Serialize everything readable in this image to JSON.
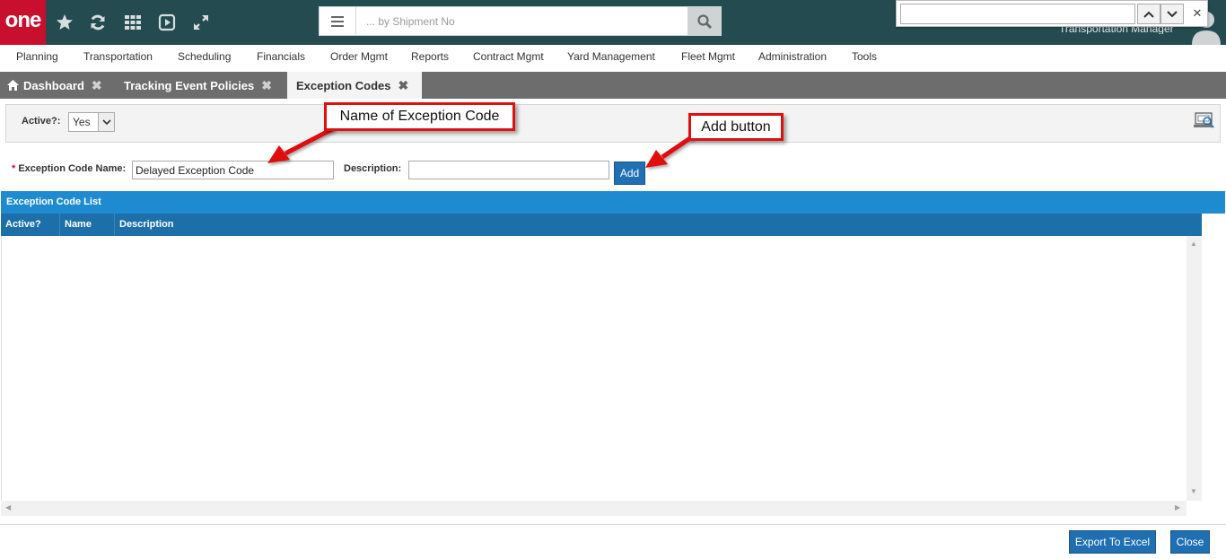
{
  "app": {
    "logo_text": "one",
    "user_role": "Transportation Manager"
  },
  "search": {
    "placeholder": "... by Shipment No"
  },
  "findbar": {
    "value": ""
  },
  "menu": [
    {
      "label": "Planning"
    },
    {
      "label": "Transportation"
    },
    {
      "label": "Scheduling"
    },
    {
      "label": "Financials"
    },
    {
      "label": "Order Mgmt"
    },
    {
      "label": "Reports"
    },
    {
      "label": "Contract Mgmt"
    },
    {
      "label": "Yard Management"
    },
    {
      "label": "Fleet Mgmt"
    },
    {
      "label": "Administration"
    },
    {
      "label": "Tools"
    }
  ],
  "tabs": [
    {
      "label": "Dashboard",
      "icon": "home-icon"
    },
    {
      "label": "Tracking Event Policies"
    },
    {
      "label": "Exception Codes",
      "active": true
    }
  ],
  "filter": {
    "active_label": "Active?:",
    "active_value": "Yes"
  },
  "form": {
    "required_mark": "*",
    "name_label": "Exception Code Name:",
    "name_value": "Delayed Exception Code",
    "description_label": "Description:",
    "description_value": "",
    "add_label": "Add"
  },
  "grid": {
    "title": "Exception Code List",
    "columns": [
      "Active?",
      "Name",
      "Description"
    ],
    "rows": []
  },
  "footer": {
    "export_label": "Export To Excel",
    "close_label": "Close"
  },
  "callouts": {
    "name": "Name of Exception Code",
    "add": "Add button"
  },
  "colors": {
    "topbar": "#244b4f",
    "logo": "#c8102e",
    "accent_blue": "#1e8bd0",
    "button_blue": "#1f6fb2",
    "callout_red": "#e01010"
  }
}
